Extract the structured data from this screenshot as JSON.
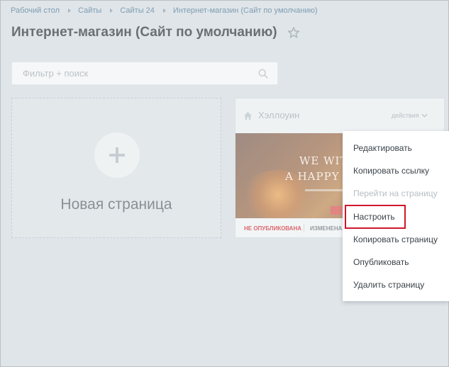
{
  "breadcrumb": [
    "Рабочий стол",
    "Сайты",
    "Сайты 24",
    "Интернет-магазин (Сайт по умолчанию)"
  ],
  "page": {
    "title": "Интернет-магазин (Сайт по умолчанию)",
    "star_icon": "star-icon"
  },
  "search": {
    "placeholder": "Фильтр + поиск",
    "value": "",
    "icon": "search-icon"
  },
  "new_page_card": {
    "label": "Новая страница",
    "icon": "plus-icon"
  },
  "site_card": {
    "title": "Хэллоуин",
    "actions_label": "действия",
    "home_icon": "home-icon",
    "preview_line1": "WE WITC",
    "preview_line2": "A HAPPY HA",
    "status": "НЕ ОПУБЛИКОВАНА",
    "changed": "ИЗМЕНЕНА"
  },
  "context_menu": {
    "items": [
      {
        "label": "Редактировать",
        "disabled": false
      },
      {
        "label": "Копировать ссылку",
        "disabled": false
      },
      {
        "label": "Перейти на страницу",
        "disabled": true
      },
      {
        "label": "Настроить",
        "disabled": false,
        "highlighted": true
      },
      {
        "label": "Копировать страницу",
        "disabled": false
      },
      {
        "label": "Опубликовать",
        "disabled": false
      },
      {
        "label": "Удалить страницу",
        "disabled": false
      }
    ],
    "highlight_color": "#d1162a"
  },
  "colors": {
    "background": "#dde4e8",
    "link": "#4a7596",
    "status_red": "#d8242b"
  }
}
